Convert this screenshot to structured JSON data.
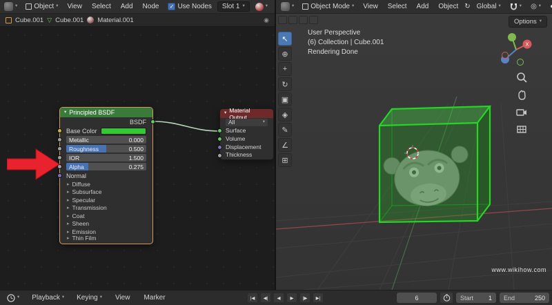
{
  "icons": {
    "caret": "▾",
    "check": "✓",
    "expand": "▸",
    "collapse": "▾",
    "mesh_glyph": "▽",
    "pin_glyph": "◉",
    "pivot_glyph": "↻",
    "proportional_glyph": "◎",
    "shading_solid_glyph": "◐",
    "shading_rendered_glyph": "○"
  },
  "colors": {
    "accent_blue": "#4772b3",
    "node_header_green": "#3a7a3a",
    "node_header_red": "#6e2a2a",
    "base_color_swatch": "#35c835",
    "arrow_red": "#e8232d",
    "cube_edge_green": "#25d625"
  },
  "shader_editor": {
    "header": {
      "shader_type": "Object",
      "menus": [
        "View",
        "Select",
        "Add",
        "Node"
      ],
      "use_nodes": "Use Nodes",
      "slot": "Slot 1"
    },
    "breadcrumb": {
      "object_name": "Cube.001",
      "mesh_name": "Cube.001",
      "material_name": "Material.001"
    },
    "principled": {
      "title": "Principled BSDF",
      "output_label": "BSDF",
      "base_color_label": "Base Color",
      "sliders": [
        {
          "label": "Metallic",
          "value": "0.000",
          "fill_pct": 0
        },
        {
          "label": "Roughness",
          "value": "0.500",
          "fill_pct": 50
        },
        {
          "label": "IOR",
          "value": "1.500",
          "fill_pct": 0
        },
        {
          "label": "Alpha",
          "value": "0.275",
          "fill_pct": 27.5
        }
      ],
      "normal_label": "Normal",
      "sections": [
        "Diffuse",
        "Subsurface",
        "Specular",
        "Transmission",
        "Coat",
        "Sheen",
        "Emission",
        "Thin Film"
      ]
    },
    "material_output": {
      "title": "Material Output",
      "target": "All",
      "inputs": [
        "Surface",
        "Volume",
        "Displacement",
        "Thickness"
      ]
    }
  },
  "viewport": {
    "header": {
      "mode": "Object Mode",
      "menus": [
        "View",
        "Select",
        "Add",
        "Object"
      ],
      "orientation": "Global",
      "options": "Options"
    },
    "overlay": {
      "line1": "User Perspective",
      "line2": "(6) Collection | Cube.001",
      "line3": "Rendering Done"
    },
    "axis_x_label": "X",
    "watermark": "www.wikihow.com",
    "tools": [
      {
        "name": "select-box-tool",
        "glyph": "↖"
      },
      {
        "name": "cursor-tool",
        "glyph": "⊕"
      },
      {
        "name": "move-tool",
        "glyph": "+"
      },
      {
        "name": "rotate-tool",
        "glyph": "↻"
      },
      {
        "name": "scale-tool",
        "glyph": "▣"
      },
      {
        "name": "transform-tool",
        "glyph": "◈"
      },
      {
        "name": "annotate-tool",
        "glyph": "✎"
      },
      {
        "name": "measure-tool",
        "glyph": "∠"
      },
      {
        "name": "add-cube-tool",
        "glyph": "⊞"
      }
    ]
  },
  "timeline": {
    "menus": [
      "Playback",
      "Keying",
      "View",
      "Marker"
    ],
    "transport": [
      {
        "name": "jump-to-start-button",
        "glyph": "|◀"
      },
      {
        "name": "prev-keyframe-button",
        "glyph": "◀|"
      },
      {
        "name": "play-reverse-button",
        "glyph": "◀"
      },
      {
        "name": "play-button",
        "glyph": "▶"
      },
      {
        "name": "next-keyframe-button",
        "glyph": "|▶"
      },
      {
        "name": "jump-to-end-button",
        "glyph": "▶|"
      }
    ],
    "frame": "6",
    "start_label": "Start",
    "start_value": "1",
    "end_label": "End",
    "end_value": "250"
  }
}
